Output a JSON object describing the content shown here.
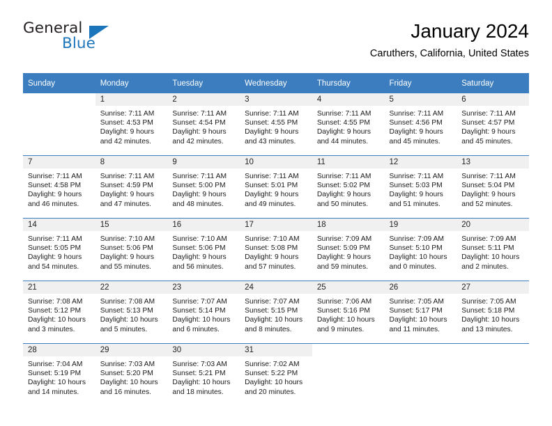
{
  "brand": {
    "name_part1": "General",
    "name_part2": "Blue",
    "accent_color": "#1b75bb"
  },
  "header": {
    "month_title": "January 2024",
    "location": "Caruthers, California, United States"
  },
  "theme": {
    "header_blue": "#3b7dbf",
    "daynum_band": "#f0f0f0",
    "cell_background": "#ffffff"
  },
  "weekday_headers": [
    "Sunday",
    "Monday",
    "Tuesday",
    "Wednesday",
    "Thursday",
    "Friday",
    "Saturday"
  ],
  "labels": {
    "sunrise_prefix": "Sunrise:",
    "sunset_prefix": "Sunset:",
    "daylight_prefix": "Daylight:"
  },
  "weeks": [
    [
      {
        "day": "",
        "sunrise": "",
        "sunset": "",
        "daylight_line1": "",
        "daylight_line2": "",
        "empty": true
      },
      {
        "day": "1",
        "sunrise": "Sunrise: 7:11 AM",
        "sunset": "Sunset: 4:53 PM",
        "daylight_line1": "Daylight: 9 hours",
        "daylight_line2": "and 42 minutes."
      },
      {
        "day": "2",
        "sunrise": "Sunrise: 7:11 AM",
        "sunset": "Sunset: 4:54 PM",
        "daylight_line1": "Daylight: 9 hours",
        "daylight_line2": "and 42 minutes."
      },
      {
        "day": "3",
        "sunrise": "Sunrise: 7:11 AM",
        "sunset": "Sunset: 4:55 PM",
        "daylight_line1": "Daylight: 9 hours",
        "daylight_line2": "and 43 minutes."
      },
      {
        "day": "4",
        "sunrise": "Sunrise: 7:11 AM",
        "sunset": "Sunset: 4:55 PM",
        "daylight_line1": "Daylight: 9 hours",
        "daylight_line2": "and 44 minutes."
      },
      {
        "day": "5",
        "sunrise": "Sunrise: 7:11 AM",
        "sunset": "Sunset: 4:56 PM",
        "daylight_line1": "Daylight: 9 hours",
        "daylight_line2": "and 45 minutes."
      },
      {
        "day": "6",
        "sunrise": "Sunrise: 7:11 AM",
        "sunset": "Sunset: 4:57 PM",
        "daylight_line1": "Daylight: 9 hours",
        "daylight_line2": "and 45 minutes."
      }
    ],
    [
      {
        "day": "7",
        "sunrise": "Sunrise: 7:11 AM",
        "sunset": "Sunset: 4:58 PM",
        "daylight_line1": "Daylight: 9 hours",
        "daylight_line2": "and 46 minutes."
      },
      {
        "day": "8",
        "sunrise": "Sunrise: 7:11 AM",
        "sunset": "Sunset: 4:59 PM",
        "daylight_line1": "Daylight: 9 hours",
        "daylight_line2": "and 47 minutes."
      },
      {
        "day": "9",
        "sunrise": "Sunrise: 7:11 AM",
        "sunset": "Sunset: 5:00 PM",
        "daylight_line1": "Daylight: 9 hours",
        "daylight_line2": "and 48 minutes."
      },
      {
        "day": "10",
        "sunrise": "Sunrise: 7:11 AM",
        "sunset": "Sunset: 5:01 PM",
        "daylight_line1": "Daylight: 9 hours",
        "daylight_line2": "and 49 minutes."
      },
      {
        "day": "11",
        "sunrise": "Sunrise: 7:11 AM",
        "sunset": "Sunset: 5:02 PM",
        "daylight_line1": "Daylight: 9 hours",
        "daylight_line2": "and 50 minutes."
      },
      {
        "day": "12",
        "sunrise": "Sunrise: 7:11 AM",
        "sunset": "Sunset: 5:03 PM",
        "daylight_line1": "Daylight: 9 hours",
        "daylight_line2": "and 51 minutes."
      },
      {
        "day": "13",
        "sunrise": "Sunrise: 7:11 AM",
        "sunset": "Sunset: 5:04 PM",
        "daylight_line1": "Daylight: 9 hours",
        "daylight_line2": "and 52 minutes."
      }
    ],
    [
      {
        "day": "14",
        "sunrise": "Sunrise: 7:11 AM",
        "sunset": "Sunset: 5:05 PM",
        "daylight_line1": "Daylight: 9 hours",
        "daylight_line2": "and 54 minutes."
      },
      {
        "day": "15",
        "sunrise": "Sunrise: 7:10 AM",
        "sunset": "Sunset: 5:06 PM",
        "daylight_line1": "Daylight: 9 hours",
        "daylight_line2": "and 55 minutes."
      },
      {
        "day": "16",
        "sunrise": "Sunrise: 7:10 AM",
        "sunset": "Sunset: 5:06 PM",
        "daylight_line1": "Daylight: 9 hours",
        "daylight_line2": "and 56 minutes."
      },
      {
        "day": "17",
        "sunrise": "Sunrise: 7:10 AM",
        "sunset": "Sunset: 5:08 PM",
        "daylight_line1": "Daylight: 9 hours",
        "daylight_line2": "and 57 minutes."
      },
      {
        "day": "18",
        "sunrise": "Sunrise: 7:09 AM",
        "sunset": "Sunset: 5:09 PM",
        "daylight_line1": "Daylight: 9 hours",
        "daylight_line2": "and 59 minutes."
      },
      {
        "day": "19",
        "sunrise": "Sunrise: 7:09 AM",
        "sunset": "Sunset: 5:10 PM",
        "daylight_line1": "Daylight: 10 hours",
        "daylight_line2": "and 0 minutes."
      },
      {
        "day": "20",
        "sunrise": "Sunrise: 7:09 AM",
        "sunset": "Sunset: 5:11 PM",
        "daylight_line1": "Daylight: 10 hours",
        "daylight_line2": "and 2 minutes."
      }
    ],
    [
      {
        "day": "21",
        "sunrise": "Sunrise: 7:08 AM",
        "sunset": "Sunset: 5:12 PM",
        "daylight_line1": "Daylight: 10 hours",
        "daylight_line2": "and 3 minutes."
      },
      {
        "day": "22",
        "sunrise": "Sunrise: 7:08 AM",
        "sunset": "Sunset: 5:13 PM",
        "daylight_line1": "Daylight: 10 hours",
        "daylight_line2": "and 5 minutes."
      },
      {
        "day": "23",
        "sunrise": "Sunrise: 7:07 AM",
        "sunset": "Sunset: 5:14 PM",
        "daylight_line1": "Daylight: 10 hours",
        "daylight_line2": "and 6 minutes."
      },
      {
        "day": "24",
        "sunrise": "Sunrise: 7:07 AM",
        "sunset": "Sunset: 5:15 PM",
        "daylight_line1": "Daylight: 10 hours",
        "daylight_line2": "and 8 minutes."
      },
      {
        "day": "25",
        "sunrise": "Sunrise: 7:06 AM",
        "sunset": "Sunset: 5:16 PM",
        "daylight_line1": "Daylight: 10 hours",
        "daylight_line2": "and 9 minutes."
      },
      {
        "day": "26",
        "sunrise": "Sunrise: 7:05 AM",
        "sunset": "Sunset: 5:17 PM",
        "daylight_line1": "Daylight: 10 hours",
        "daylight_line2": "and 11 minutes."
      },
      {
        "day": "27",
        "sunrise": "Sunrise: 7:05 AM",
        "sunset": "Sunset: 5:18 PM",
        "daylight_line1": "Daylight: 10 hours",
        "daylight_line2": "and 13 minutes."
      }
    ],
    [
      {
        "day": "28",
        "sunrise": "Sunrise: 7:04 AM",
        "sunset": "Sunset: 5:19 PM",
        "daylight_line1": "Daylight: 10 hours",
        "daylight_line2": "and 14 minutes."
      },
      {
        "day": "29",
        "sunrise": "Sunrise: 7:03 AM",
        "sunset": "Sunset: 5:20 PM",
        "daylight_line1": "Daylight: 10 hours",
        "daylight_line2": "and 16 minutes."
      },
      {
        "day": "30",
        "sunrise": "Sunrise: 7:03 AM",
        "sunset": "Sunset: 5:21 PM",
        "daylight_line1": "Daylight: 10 hours",
        "daylight_line2": "and 18 minutes."
      },
      {
        "day": "31",
        "sunrise": "Sunrise: 7:02 AM",
        "sunset": "Sunset: 5:22 PM",
        "daylight_line1": "Daylight: 10 hours",
        "daylight_line2": "and 20 minutes."
      },
      {
        "day": "",
        "sunrise": "",
        "sunset": "",
        "daylight_line1": "",
        "daylight_line2": "",
        "empty": true
      },
      {
        "day": "",
        "sunrise": "",
        "sunset": "",
        "daylight_line1": "",
        "daylight_line2": "",
        "empty": true
      },
      {
        "day": "",
        "sunrise": "",
        "sunset": "",
        "daylight_line1": "",
        "daylight_line2": "",
        "empty": true
      }
    ]
  ]
}
